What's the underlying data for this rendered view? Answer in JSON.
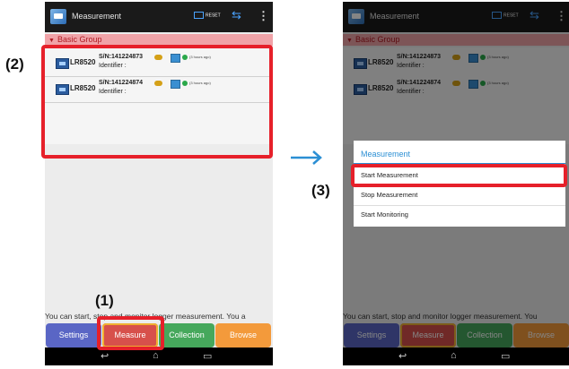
{
  "app": {
    "title": "Measurement",
    "reset_label": "RESET"
  },
  "group": {
    "name": "Basic Group"
  },
  "devices": [
    {
      "model": "LR8520",
      "serial": "S/N:141224873",
      "identifier": "Identifier :",
      "status": "(3 hours ago)"
    },
    {
      "model": "LR8520",
      "serial": "S/N:141224874",
      "identifier": "Identifier :",
      "status": "(3 hours ago)"
    }
  ],
  "info_text_left": "You can start, stop and monitor logger measurement. You a",
  "info_text_right": "You can start, stop and monitor logger measurement. You",
  "tabs": {
    "settings": "Settings",
    "measure": "Measure",
    "collection": "Collection",
    "browse": "Browse"
  },
  "dialog": {
    "title": "Measurement",
    "items": [
      "Start Measurement",
      "Stop Measurement",
      "Start Monitoring"
    ]
  },
  "callouts": {
    "one": "(1)",
    "two": "(2)",
    "three": "(3)"
  },
  "colors": {
    "callout": "#e6202a",
    "group_bar": "#f0a3a8",
    "settings_tab": "#5a66c5",
    "measure_tab": "#d7504b",
    "collection_tab": "#46a85c",
    "browse_tab": "#f39a3b",
    "dialog_accent": "#2b8fd4"
  }
}
